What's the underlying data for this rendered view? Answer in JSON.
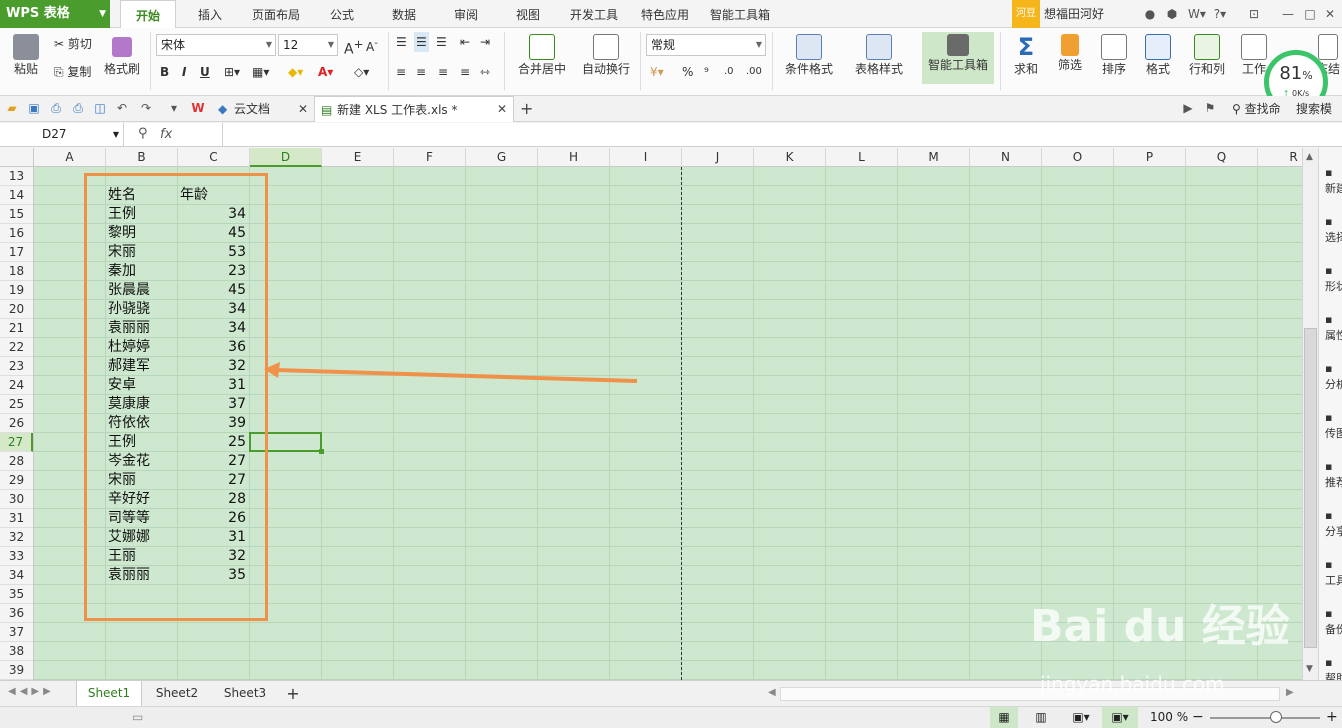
{
  "app": {
    "logo": "WPS 表格"
  },
  "menu": {
    "tabs": [
      "开始",
      "插入",
      "页面布局",
      "公式",
      "数据",
      "审阅",
      "视图",
      "开发工具",
      "特色应用",
      "智能工具箱"
    ],
    "hedou": "河豆",
    "user": "想福田河好"
  },
  "ribbon": {
    "paste": "粘贴",
    "cut": "剪切",
    "copy": "复制",
    "format_painter": "格式刷",
    "font_name": "宋体",
    "font_size": "12",
    "merge_center": "合并居中",
    "wrap": "自动换行",
    "number_format": "常规",
    "cond_format": "条件格式",
    "table_style": "表格样式",
    "smart_toolbox": "智能工具箱",
    "sum": "求和",
    "filter": "筛选",
    "sort": "排序",
    "format": "格式",
    "rowcol": "行和列",
    "worksheet": "工作",
    "freeze": "冻结",
    "percent": "%",
    "thousands": "⁹",
    "dec_inc": ".0",
    "dec_dec": ".00"
  },
  "network": {
    "percent": "81",
    "unit": "%",
    "speed": "0K/s"
  },
  "docbar": {
    "tab_cloud": "云文档",
    "tab_file": "新建 XLS 工作表.xls *",
    "search": "查找命",
    "search2": "搜索模"
  },
  "formula": {
    "namebox": "D27",
    "fx": "fx",
    "value": ""
  },
  "columns": [
    "A",
    "B",
    "C",
    "D",
    "E",
    "F",
    "G",
    "H",
    "I",
    "J",
    "K",
    "L",
    "M",
    "N",
    "O",
    "P",
    "Q",
    "R"
  ],
  "selected_col": "D",
  "rows": [
    "13",
    "14",
    "15",
    "16",
    "17",
    "18",
    "19",
    "20",
    "21",
    "22",
    "23",
    "24",
    "25",
    "26",
    "27",
    "28",
    "29",
    "30",
    "31",
    "32",
    "33",
    "34",
    "35",
    "36",
    "37",
    "38",
    "39"
  ],
  "selected_row": "27",
  "table": {
    "header_name": "姓名",
    "header_age": "年龄",
    "records": [
      {
        "name": "王例",
        "age": "34"
      },
      {
        "name": "黎明",
        "age": "45"
      },
      {
        "name": "宋丽",
        "age": "53"
      },
      {
        "name": "秦加",
        "age": "23"
      },
      {
        "name": "张晨晨",
        "age": "45"
      },
      {
        "name": "孙骁骁",
        "age": "34"
      },
      {
        "name": "袁丽丽",
        "age": "34"
      },
      {
        "name": "杜婷婷",
        "age": "36"
      },
      {
        "name": "郝建军",
        "age": "32"
      },
      {
        "name": "安卓",
        "age": "31"
      },
      {
        "name": "莫康康",
        "age": "37"
      },
      {
        "name": "符依依",
        "age": "39"
      },
      {
        "name": "王例",
        "age": "25"
      },
      {
        "name": "岑金花",
        "age": "27"
      },
      {
        "name": "宋丽",
        "age": "27"
      },
      {
        "name": "辛好好",
        "age": "28"
      },
      {
        "name": "司等等",
        "age": "26"
      },
      {
        "name": "艾娜娜",
        "age": "31"
      },
      {
        "name": "王丽",
        "age": "32"
      },
      {
        "name": "袁丽丽",
        "age": "35"
      }
    ]
  },
  "sheets": [
    "Sheet1",
    "Sheet2",
    "Sheet3"
  ],
  "status": {
    "zoom": "100 %"
  },
  "right_panel": [
    "新建",
    "选择",
    "形状",
    "属性",
    "分析",
    "传图",
    "推荐",
    "分享",
    "工具",
    "备份",
    "帮助"
  ],
  "watermark": {
    "logo": "Bai du 经验",
    "url": "jingyan.baidu.com"
  },
  "colors": {
    "accent": "#4a9c2c",
    "grid_bg": "#cde8cf",
    "highlight": "#f0914a"
  }
}
